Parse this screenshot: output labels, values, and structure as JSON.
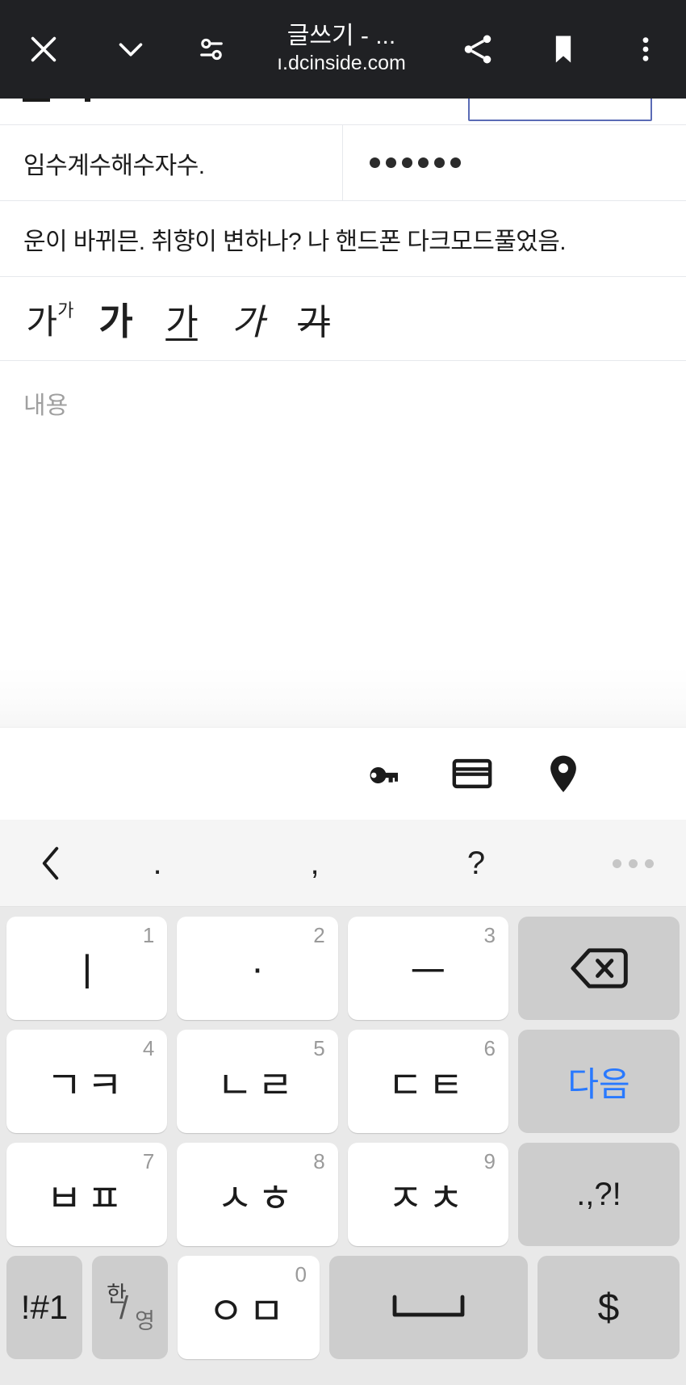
{
  "browser": {
    "title": "글쓰기 - ...",
    "url": "ı.dcinside.com",
    "icons": {
      "close": "close-icon",
      "collapse": "chevron-down-icon",
      "site_settings": "tune-icon",
      "share": "share-icon",
      "bookmark": "bookmark-icon",
      "overflow": "more-vertical-icon"
    }
  },
  "form": {
    "nickname": "임수계수해수자수.",
    "password_mask": "••••••",
    "password_dot_count": 6,
    "subject": "운이 바뀌믄. 취향이 변하나? 나 핸드폰 다크모드풀었음.",
    "content_placeholder": "내용",
    "format_toolbar": [
      {
        "label": "가",
        "sup": "가",
        "name": "font-size"
      },
      {
        "label": "가",
        "name": "bold"
      },
      {
        "label": "가",
        "name": "underline"
      },
      {
        "label": "가",
        "name": "italic"
      },
      {
        "label": "가",
        "name": "strikethrough"
      }
    ]
  },
  "autofill": {
    "items": [
      {
        "name": "password-key-icon"
      },
      {
        "name": "credit-card-icon"
      },
      {
        "name": "location-pin-icon"
      }
    ]
  },
  "keyboard": {
    "suggestion_bar": {
      "back": "‹",
      "items": [
        ".",
        ",",
        "?"
      ],
      "overflow": "•••"
    },
    "rows": [
      [
        {
          "label": "ㅣ",
          "num": "1",
          "style": "light"
        },
        {
          "label": "·",
          "num": "2",
          "style": "light"
        },
        {
          "label": "ㅡ",
          "num": "3",
          "style": "light"
        },
        {
          "label": "⌫",
          "style": "dark",
          "name": "backspace"
        }
      ],
      [
        {
          "label": "ㄱㅋ",
          "num": "4",
          "style": "light"
        },
        {
          "label": "ㄴㄹ",
          "num": "5",
          "style": "light"
        },
        {
          "label": "ㄷㅌ",
          "num": "6",
          "style": "light"
        },
        {
          "label": "다음",
          "style": "dark",
          "name": "next"
        }
      ],
      [
        {
          "label": "ㅂㅍ",
          "num": "7",
          "style": "light"
        },
        {
          "label": "ㅅㅎ",
          "num": "8",
          "style": "light"
        },
        {
          "label": "ㅈㅊ",
          "num": "9",
          "style": "light"
        },
        {
          "label": ".,?!",
          "style": "dark",
          "name": "punctuation"
        }
      ],
      [
        {
          "label": "!#1",
          "style": "dark",
          "name": "symbols"
        },
        {
          "label": "한/영",
          "style": "dark",
          "name": "language-toggle"
        },
        {
          "label": "ㅇㅁ",
          "num": "0",
          "style": "light"
        },
        {
          "label": "␣",
          "style": "dark",
          "name": "space"
        },
        {
          "label": "$",
          "style": "dark",
          "name": "currency"
        }
      ]
    ],
    "next_key_color": "#2979ff"
  },
  "colors": {
    "topbar_bg": "#202124",
    "page_bg": "#ffffff",
    "keyboard_bg": "#e9e9e9",
    "key_light": "#ffffff",
    "key_dark": "#cdcdcd",
    "accent_blue": "#2979ff",
    "border_blue": "#5a6bb5"
  }
}
